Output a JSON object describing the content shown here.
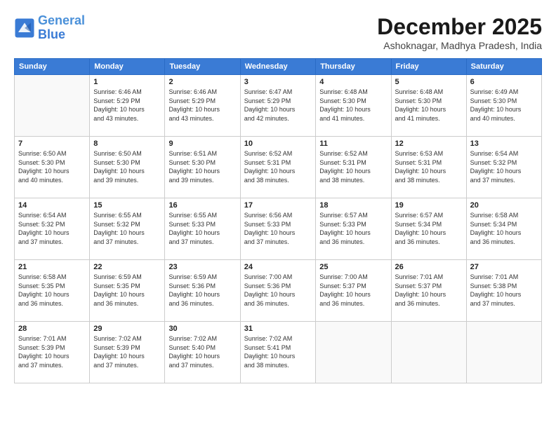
{
  "header": {
    "logo_line1": "General",
    "logo_line2": "Blue",
    "month_title": "December 2025",
    "subtitle": "Ashoknagar, Madhya Pradesh, India"
  },
  "days_of_week": [
    "Sunday",
    "Monday",
    "Tuesday",
    "Wednesday",
    "Thursday",
    "Friday",
    "Saturday"
  ],
  "weeks": [
    [
      {
        "day": "",
        "info": ""
      },
      {
        "day": "1",
        "info": "Sunrise: 6:46 AM\nSunset: 5:29 PM\nDaylight: 10 hours\nand 43 minutes."
      },
      {
        "day": "2",
        "info": "Sunrise: 6:46 AM\nSunset: 5:29 PM\nDaylight: 10 hours\nand 43 minutes."
      },
      {
        "day": "3",
        "info": "Sunrise: 6:47 AM\nSunset: 5:29 PM\nDaylight: 10 hours\nand 42 minutes."
      },
      {
        "day": "4",
        "info": "Sunrise: 6:48 AM\nSunset: 5:30 PM\nDaylight: 10 hours\nand 41 minutes."
      },
      {
        "day": "5",
        "info": "Sunrise: 6:48 AM\nSunset: 5:30 PM\nDaylight: 10 hours\nand 41 minutes."
      },
      {
        "day": "6",
        "info": "Sunrise: 6:49 AM\nSunset: 5:30 PM\nDaylight: 10 hours\nand 40 minutes."
      }
    ],
    [
      {
        "day": "7",
        "info": "Sunrise: 6:50 AM\nSunset: 5:30 PM\nDaylight: 10 hours\nand 40 minutes."
      },
      {
        "day": "8",
        "info": "Sunrise: 6:50 AM\nSunset: 5:30 PM\nDaylight: 10 hours\nand 39 minutes."
      },
      {
        "day": "9",
        "info": "Sunrise: 6:51 AM\nSunset: 5:30 PM\nDaylight: 10 hours\nand 39 minutes."
      },
      {
        "day": "10",
        "info": "Sunrise: 6:52 AM\nSunset: 5:31 PM\nDaylight: 10 hours\nand 38 minutes."
      },
      {
        "day": "11",
        "info": "Sunrise: 6:52 AM\nSunset: 5:31 PM\nDaylight: 10 hours\nand 38 minutes."
      },
      {
        "day": "12",
        "info": "Sunrise: 6:53 AM\nSunset: 5:31 PM\nDaylight: 10 hours\nand 38 minutes."
      },
      {
        "day": "13",
        "info": "Sunrise: 6:54 AM\nSunset: 5:32 PM\nDaylight: 10 hours\nand 37 minutes."
      }
    ],
    [
      {
        "day": "14",
        "info": "Sunrise: 6:54 AM\nSunset: 5:32 PM\nDaylight: 10 hours\nand 37 minutes."
      },
      {
        "day": "15",
        "info": "Sunrise: 6:55 AM\nSunset: 5:32 PM\nDaylight: 10 hours\nand 37 minutes."
      },
      {
        "day": "16",
        "info": "Sunrise: 6:55 AM\nSunset: 5:33 PM\nDaylight: 10 hours\nand 37 minutes."
      },
      {
        "day": "17",
        "info": "Sunrise: 6:56 AM\nSunset: 5:33 PM\nDaylight: 10 hours\nand 37 minutes."
      },
      {
        "day": "18",
        "info": "Sunrise: 6:57 AM\nSunset: 5:33 PM\nDaylight: 10 hours\nand 36 minutes."
      },
      {
        "day": "19",
        "info": "Sunrise: 6:57 AM\nSunset: 5:34 PM\nDaylight: 10 hours\nand 36 minutes."
      },
      {
        "day": "20",
        "info": "Sunrise: 6:58 AM\nSunset: 5:34 PM\nDaylight: 10 hours\nand 36 minutes."
      }
    ],
    [
      {
        "day": "21",
        "info": "Sunrise: 6:58 AM\nSunset: 5:35 PM\nDaylight: 10 hours\nand 36 minutes."
      },
      {
        "day": "22",
        "info": "Sunrise: 6:59 AM\nSunset: 5:35 PM\nDaylight: 10 hours\nand 36 minutes."
      },
      {
        "day": "23",
        "info": "Sunrise: 6:59 AM\nSunset: 5:36 PM\nDaylight: 10 hours\nand 36 minutes."
      },
      {
        "day": "24",
        "info": "Sunrise: 7:00 AM\nSunset: 5:36 PM\nDaylight: 10 hours\nand 36 minutes."
      },
      {
        "day": "25",
        "info": "Sunrise: 7:00 AM\nSunset: 5:37 PM\nDaylight: 10 hours\nand 36 minutes."
      },
      {
        "day": "26",
        "info": "Sunrise: 7:01 AM\nSunset: 5:37 PM\nDaylight: 10 hours\nand 36 minutes."
      },
      {
        "day": "27",
        "info": "Sunrise: 7:01 AM\nSunset: 5:38 PM\nDaylight: 10 hours\nand 37 minutes."
      }
    ],
    [
      {
        "day": "28",
        "info": "Sunrise: 7:01 AM\nSunset: 5:39 PM\nDaylight: 10 hours\nand 37 minutes."
      },
      {
        "day": "29",
        "info": "Sunrise: 7:02 AM\nSunset: 5:39 PM\nDaylight: 10 hours\nand 37 minutes."
      },
      {
        "day": "30",
        "info": "Sunrise: 7:02 AM\nSunset: 5:40 PM\nDaylight: 10 hours\nand 37 minutes."
      },
      {
        "day": "31",
        "info": "Sunrise: 7:02 AM\nSunset: 5:41 PM\nDaylight: 10 hours\nand 38 minutes."
      },
      {
        "day": "",
        "info": ""
      },
      {
        "day": "",
        "info": ""
      },
      {
        "day": "",
        "info": ""
      }
    ]
  ]
}
